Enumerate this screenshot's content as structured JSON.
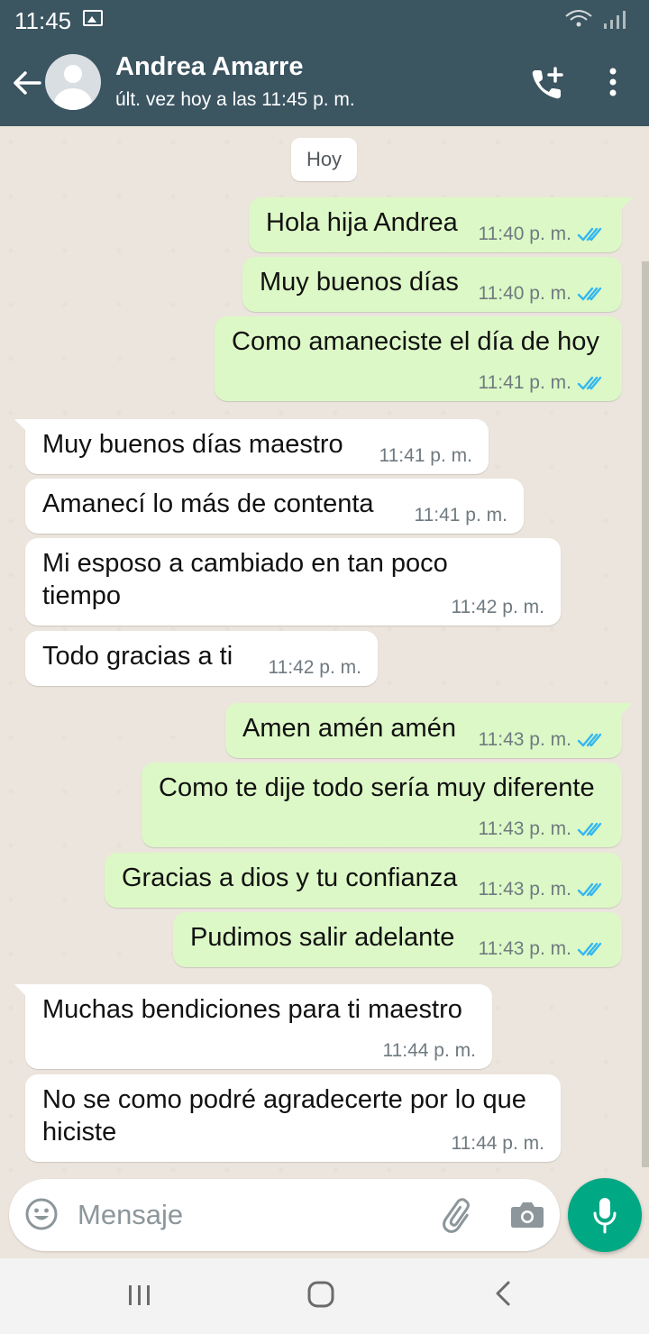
{
  "status_bar": {
    "time": "11:45"
  },
  "header": {
    "contact_name": "Andrea Amarre",
    "last_seen": "últ. vez hoy a las 11:45 p. m."
  },
  "chat": {
    "date_chip": "Hoy",
    "messages": [
      {
        "direction": "out",
        "text": "Hola hija Andrea",
        "time": "11:40 p. m.",
        "status": "read"
      },
      {
        "direction": "out",
        "text": "Muy buenos días",
        "time": "11:40 p. m.",
        "status": "read"
      },
      {
        "direction": "out",
        "text": "Como amaneciste el día de hoy",
        "time": "11:41 p. m.",
        "status": "read"
      },
      {
        "direction": "in",
        "text": "Muy buenos días maestro",
        "time": "11:41 p. m."
      },
      {
        "direction": "in",
        "text": "Amanecí lo más de contenta",
        "time": "11:41 p. m."
      },
      {
        "direction": "in",
        "text_lines": [
          "Mi esposo a cambiado en tan poco",
          "tiempo"
        ],
        "time": "11:42 p. m."
      },
      {
        "direction": "in",
        "text": "Todo gracias a ti",
        "time": "11:42 p. m."
      },
      {
        "direction": "out",
        "text": "Amen amén amén",
        "time": "11:43 p. m.",
        "status": "read"
      },
      {
        "direction": "out",
        "text": "Como te dije todo sería muy diferente",
        "time": "11:43 p. m.",
        "status": "read"
      },
      {
        "direction": "out",
        "text": "Gracias a dios y tu confianza",
        "time": "11:43 p. m.",
        "status": "read"
      },
      {
        "direction": "out",
        "text": "Pudimos salir adelante",
        "time": "11:43 p. m.",
        "status": "read"
      },
      {
        "direction": "in",
        "text": "Muchas bendiciones para ti maestro",
        "time": "11:44 p. m."
      },
      {
        "direction": "in",
        "text_lines": [
          "No se como podré agradecerte por lo que",
          "hiciste"
        ],
        "time": "11:44 p. m."
      }
    ]
  },
  "composer": {
    "placeholder": "Mensaje"
  },
  "colors": {
    "header": "#3B5561",
    "outgoing_bubble": "#DCF8C6",
    "incoming_bubble": "#FFFFFF",
    "chat_background": "#ECE5DD",
    "read_ticks": "#34B7F1",
    "mic_button": "#00A884"
  },
  "icons": [
    "image-icon",
    "wifi-icon",
    "signal-icon",
    "back-arrow-icon",
    "avatar-icon",
    "add-call-icon",
    "more-options-icon",
    "read-receipt-icon",
    "emoji-icon",
    "attach-icon",
    "camera-icon",
    "microphone-icon",
    "nav-recents-icon",
    "nav-home-icon",
    "nav-back-icon"
  ]
}
